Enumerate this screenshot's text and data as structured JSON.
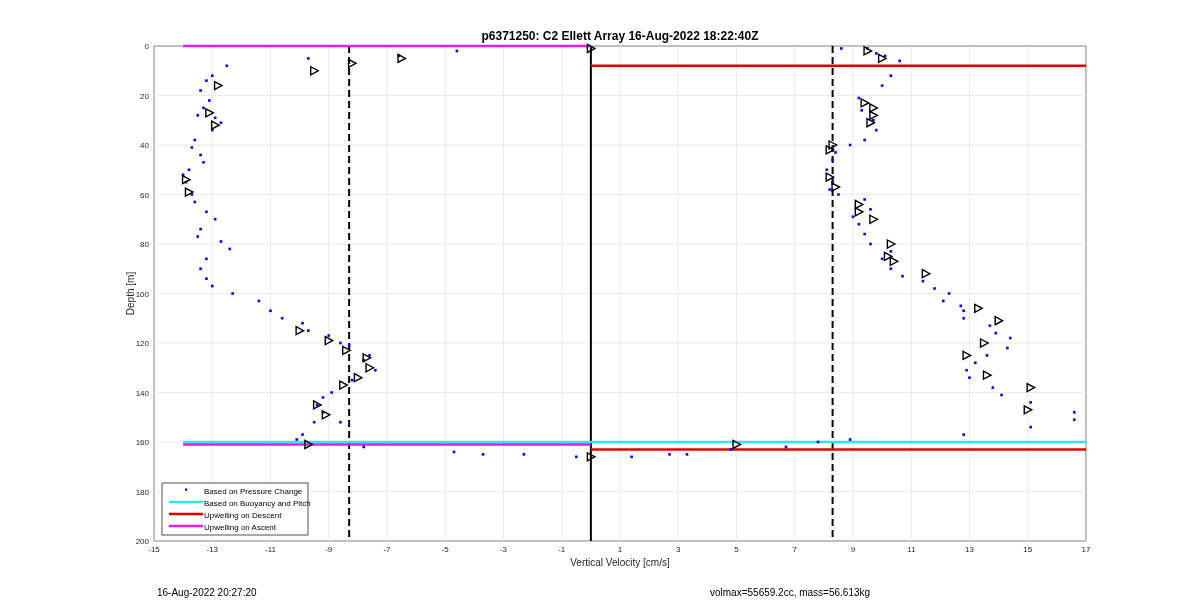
{
  "figure": {
    "chart_data": {
      "type": "scatter",
      "title": "p6371250: C2 Ellett Array 16-Aug-2022 18:22:40Z",
      "xlabel": "Vertical Velocity [cm/s]",
      "ylabel": "Depth [m]",
      "xlim": [
        -15,
        17
      ],
      "ylim": [
        200,
        0
      ],
      "xticks": [
        -15,
        -13,
        -11,
        -9,
        -7,
        -5,
        -3,
        -1,
        1,
        3,
        5,
        7,
        9,
        11,
        13,
        15,
        17
      ],
      "yticks": [
        0,
        20,
        40,
        60,
        80,
        100,
        120,
        140,
        160,
        180,
        200
      ],
      "series": [
        {
          "name": "Based on Pressure Change",
          "color": "#0000ff",
          "type": "scatter",
          "marker": "square",
          "x": [
            -12.5,
            -13,
            -13.2,
            -13.4,
            -13.1,
            -13.3,
            -13.5,
            -12.9,
            -12.7,
            -13,
            -13.6,
            -13.7,
            -13.4,
            -13.3,
            -13.8,
            -14,
            -13.9,
            -13.7,
            -13.6,
            -13.2,
            -12.9,
            -13.4,
            -13.5,
            -12.7,
            -12.4,
            -13.2,
            -13.4,
            -13.2,
            -13,
            -12.3,
            -11.4,
            -11,
            -10.6,
            -9.9,
            -9.7,
            -9,
            -8.6,
            -8.3,
            -7.6,
            -7.8,
            -7.4,
            -8.2,
            -8.9,
            -9.2,
            -9.4,
            -9.2,
            -9.5,
            -8.6,
            -9.9,
            -10.1,
            -7.8,
            -4.7,
            -3.7,
            -2.3,
            -0.5,
            1.4,
            2.7,
            3.3,
            4.8,
            6.7,
            7.8,
            8.9,
            12.8,
            15.1,
            16.6,
            16.6,
            15.1,
            14.1,
            13.8,
            13,
            12.9,
            13.2,
            13.6,
            14.3,
            14.4,
            13.9,
            13.7,
            12.8,
            12.8,
            12.7,
            12.1,
            12.3,
            11.8,
            11.4,
            10.7,
            10.3,
            10,
            10.3,
            9.6,
            9.4,
            9.2,
            9,
            9.6,
            9.4,
            8.5,
            8.2,
            8.3,
            8.1,
            8.3,
            8.4,
            8.9,
            9.4,
            9.8,
            9.7,
            9.3,
            9.2,
            10,
            10.3,
            10.6,
            10.1,
            9.8,
            9.5,
            8.6,
            -4.6,
            -6.6,
            -9.7
          ],
          "values": [
            8,
            12,
            14,
            18,
            22,
            25,
            28,
            29,
            31,
            34,
            38,
            41,
            44,
            47,
            50,
            52,
            55,
            60,
            63,
            67,
            70,
            74,
            77,
            79,
            82,
            86,
            90,
            94,
            97,
            100,
            103,
            107,
            110,
            112,
            115,
            117,
            120,
            121,
            125,
            127,
            131,
            135,
            140,
            142,
            145,
            148,
            152,
            152,
            157,
            159,
            162,
            164,
            165,
            165,
            166,
            166,
            165,
            165,
            163,
            162,
            160,
            159,
            157,
            154,
            148,
            151,
            144,
            141,
            138,
            134,
            131,
            128,
            125,
            122,
            118,
            116,
            113,
            110,
            107,
            105,
            103,
            100,
            98,
            95,
            93,
            90,
            86,
            83,
            80,
            76,
            72,
            69,
            66,
            62,
            60,
            58,
            55,
            50,
            46,
            43,
            40,
            38,
            34,
            30,
            26,
            21,
            16,
            12,
            6,
            4,
            3,
            1,
            1,
            2,
            4,
            5
          ]
        },
        {
          "color": "#000000",
          "type": "scatter",
          "marker": "triangle",
          "x": [
            -12.8,
            -13.1,
            -12.9,
            -13.9,
            -13.8,
            -10,
            -9,
            -8.4,
            -7.7,
            -7.6,
            -8,
            -8.5,
            -9.4,
            -9.1,
            -9.7,
            -8.2,
            -9.5,
            -6.5,
            0,
            0,
            5,
            9.5,
            10,
            9.4,
            9.7,
            9.7,
            9.6,
            8.3,
            8.2,
            8.2,
            8.4,
            9.2,
            9.2,
            9.7,
            10.3,
            10.2,
            10.4,
            11.5,
            13.3,
            14,
            13.5,
            12.9,
            13.6,
            15.1,
            15
          ],
          "values": [
            16,
            27,
            32,
            54,
            59,
            115,
            119,
            123,
            126,
            130,
            134,
            137,
            145,
            149,
            161,
            7,
            10,
            5,
            1,
            166,
            161,
            2,
            5,
            23,
            25,
            28,
            31,
            40,
            42,
            53,
            57,
            64,
            67,
            70,
            80,
            85,
            87,
            92,
            106,
            111,
            120,
            125,
            133,
            138,
            147
          ]
        },
        {
          "name": "Based on Buoyancy and Pitch",
          "color": "#33e6e6",
          "type": "line",
          "x": [
            -14,
            17
          ],
          "values": [
            160,
            160
          ]
        },
        {
          "name": "Upwelling on Descent",
          "color": "#e00000",
          "type": "line",
          "x": [
            0,
            17
          ],
          "values": [
            8,
            8
          ]
        },
        {
          "color": "#e00000",
          "type": "line",
          "x": [
            0,
            17
          ],
          "values": [
            163,
            163
          ]
        },
        {
          "name": "Upwelling on Ascent",
          "color": "#e020e0",
          "type": "line",
          "x": [
            -14,
            0
          ],
          "values": [
            0,
            0
          ]
        },
        {
          "color": "#e020e0",
          "type": "line",
          "x": [
            -14,
            0
          ],
          "values": [
            161,
            161
          ]
        }
      ],
      "ref_lines": [
        {
          "axis": "x",
          "value": -8.3
        },
        {
          "axis": "x",
          "value": 8.3
        },
        {
          "axis": "x",
          "value": 0
        }
      ],
      "grid": true,
      "legend": true
    }
  },
  "footer": {
    "timestamp": "16-Aug-2022 20:27:20",
    "parameters": "volmax=55659.2cc, mass=56.613kg"
  }
}
